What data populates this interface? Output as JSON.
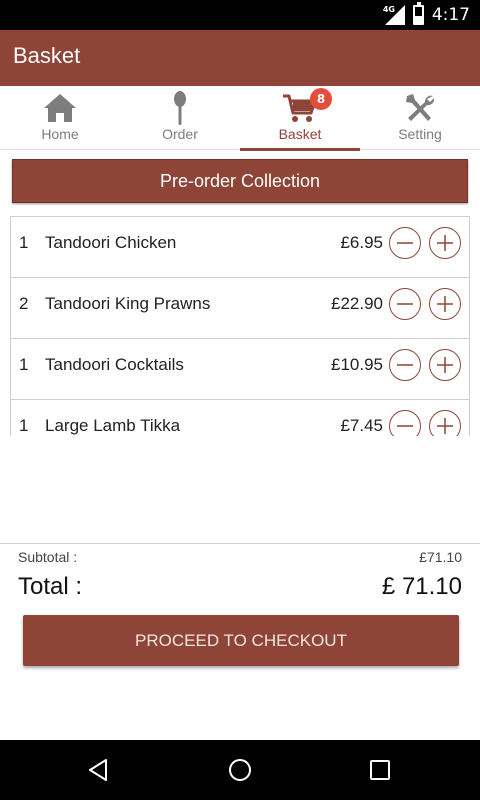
{
  "status_bar": {
    "time": "4:17",
    "network": "4G"
  },
  "app_bar": {
    "title": "Basket"
  },
  "tabs": [
    {
      "label": "Home",
      "icon": "home-icon"
    },
    {
      "label": "Order",
      "icon": "spoon-icon"
    },
    {
      "label": "Basket",
      "icon": "cart-icon",
      "badge": "8",
      "active": true
    },
    {
      "label": "Setting",
      "icon": "tools-icon"
    }
  ],
  "section_header": {
    "label": "Pre-order Collection"
  },
  "items": [
    {
      "qty": "1",
      "name": "Tandoori Chicken",
      "price": "£6.95"
    },
    {
      "qty": "2",
      "name": "Tandoori King Prawns",
      "price": "£22.90"
    },
    {
      "qty": "1",
      "name": "Tandoori Cocktails",
      "price": "£10.95"
    },
    {
      "qty": "1",
      "name": "Large Lamb Tikka",
      "price": "£7.45"
    }
  ],
  "totals": {
    "subtotal_label": "Subtotal :",
    "subtotal_value": "£71.10",
    "total_label": "Total :",
    "total_value": "£ 71.10"
  },
  "checkout": {
    "label": "PROCEED TO CHECKOUT"
  },
  "colors": {
    "primary": "#8e4436",
    "badge": "#e54c3c",
    "inactive": "#7d7d7d"
  }
}
